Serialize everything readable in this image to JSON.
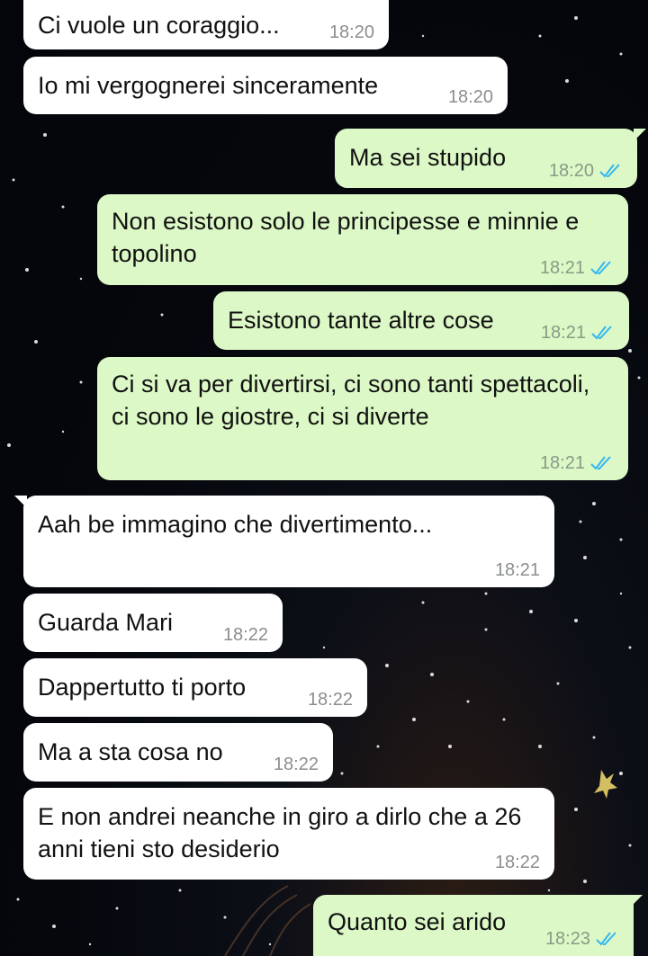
{
  "colors": {
    "incoming_bubble": "#ffffff",
    "outgoing_bubble": "#dcf8c6",
    "read_check": "#34b7f1",
    "background": "#05070d"
  },
  "icons": {
    "read_receipt": "double-check-icon"
  },
  "messages": [
    {
      "direction": "incoming",
      "text": "Ci vuole un coraggio...",
      "time": "18:20"
    },
    {
      "direction": "incoming",
      "text": "Io mi vergognerei sinceramente",
      "time": "18:20"
    },
    {
      "direction": "outgoing",
      "text": "Ma sei stupido",
      "time": "18:20",
      "status": "read"
    },
    {
      "direction": "outgoing",
      "text": "Non esistono solo le principesse e minnie e topolino",
      "time": "18:21",
      "status": "read"
    },
    {
      "direction": "outgoing",
      "text": "Esistono tante altre cose",
      "time": "18:21",
      "status": "read"
    },
    {
      "direction": "outgoing",
      "text": "Ci si va per divertirsi, ci sono tanti spettacoli, ci sono le giostre, ci si diverte",
      "time": "18:21",
      "status": "read"
    },
    {
      "direction": "incoming",
      "text": "Aah be immagino che divertimento...",
      "time": "18:21"
    },
    {
      "direction": "incoming",
      "text": "Guarda Mari",
      "time": "18:22"
    },
    {
      "direction": "incoming",
      "text": "Dappertutto ti porto",
      "time": "18:22"
    },
    {
      "direction": "incoming",
      "text": "Ma a sta cosa no",
      "time": "18:22"
    },
    {
      "direction": "incoming",
      "text": "E non andrei neanche in giro a dirlo che a 26 anni tieni sto desiderio",
      "time": "18:22"
    },
    {
      "direction": "outgoing",
      "text": "Quanto sei arido",
      "time": "18:23",
      "status": "read"
    }
  ]
}
